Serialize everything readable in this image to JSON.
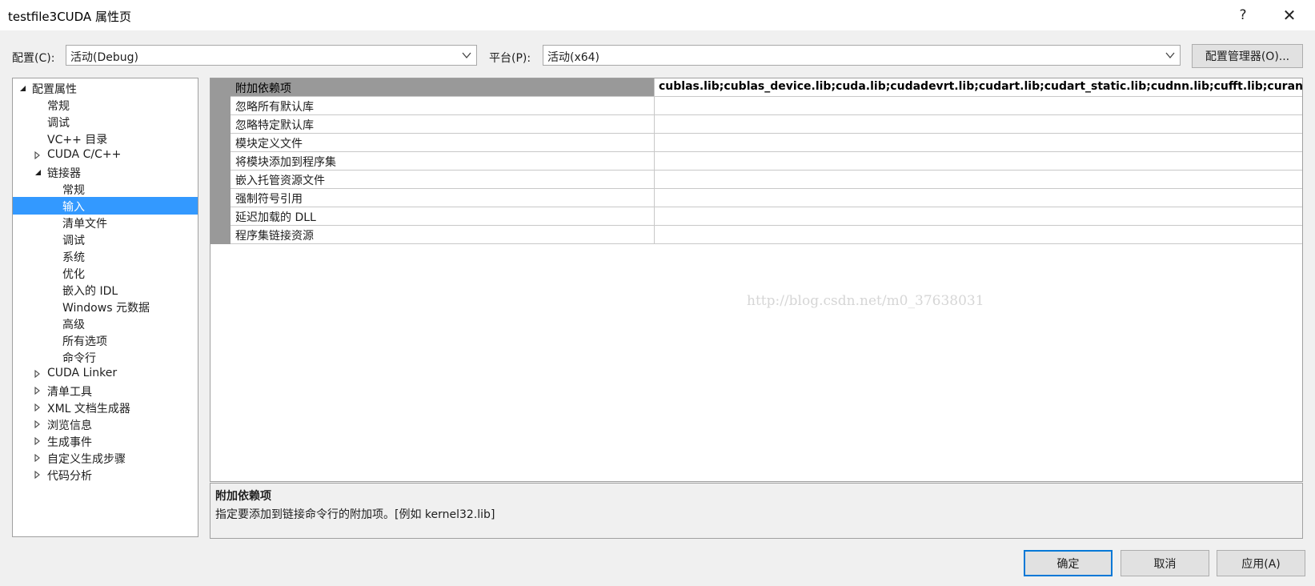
{
  "window": {
    "title": "testfile3CUDA 属性页",
    "help_label": "?",
    "close_label": "✕"
  },
  "config": {
    "config_label": "配置(C):",
    "config_value": "活动(Debug)",
    "platform_label": "平台(P):",
    "platform_value": "活动(x64)",
    "manager_button": "配置管理器(O)..."
  },
  "tree": {
    "items": [
      {
        "label": "配置属性",
        "expander": "expanded",
        "selected": false
      },
      {
        "label": "常规",
        "expander": "none",
        "selected": false
      },
      {
        "label": "调试",
        "expander": "none",
        "selected": false
      },
      {
        "label": "VC++ 目录",
        "expander": "none",
        "selected": false
      },
      {
        "label": "CUDA C/C++",
        "expander": "collapsed",
        "selected": false
      },
      {
        "label": "链接器",
        "expander": "expanded",
        "selected": false
      },
      {
        "label": "常规",
        "expander": "none",
        "selected": false
      },
      {
        "label": "输入",
        "expander": "none",
        "selected": true
      },
      {
        "label": "清单文件",
        "expander": "none",
        "selected": false
      },
      {
        "label": "调试",
        "expander": "none",
        "selected": false
      },
      {
        "label": "系统",
        "expander": "none",
        "selected": false
      },
      {
        "label": "优化",
        "expander": "none",
        "selected": false
      },
      {
        "label": "嵌入的 IDL",
        "expander": "none",
        "selected": false
      },
      {
        "label": "Windows 元数据",
        "expander": "none",
        "selected": false
      },
      {
        "label": "高级",
        "expander": "none",
        "selected": false
      },
      {
        "label": "所有选项",
        "expander": "none",
        "selected": false
      },
      {
        "label": "命令行",
        "expander": "none",
        "selected": false
      },
      {
        "label": "CUDA Linker",
        "expander": "collapsed",
        "selected": false
      },
      {
        "label": "清单工具",
        "expander": "collapsed",
        "selected": false
      },
      {
        "label": "XML 文档生成器",
        "expander": "collapsed",
        "selected": false
      },
      {
        "label": "浏览信息",
        "expander": "collapsed",
        "selected": false
      },
      {
        "label": "生成事件",
        "expander": "collapsed",
        "selected": false
      },
      {
        "label": "自定义生成步骤",
        "expander": "collapsed",
        "selected": false
      },
      {
        "label": "代码分析",
        "expander": "collapsed",
        "selected": false
      }
    ]
  },
  "properties": {
    "rows": [
      {
        "name": "附加依赖项",
        "value": "cublas.lib;cublas_device.lib;cuda.lib;cudadevrt.lib;cudart.lib;cudart_static.lib;cudnn.lib;cufft.lib;curand.lib;cus",
        "selected": true
      },
      {
        "name": "忽略所有默认库",
        "value": "",
        "selected": false
      },
      {
        "name": "忽略特定默认库",
        "value": "",
        "selected": false
      },
      {
        "name": "模块定义文件",
        "value": "",
        "selected": false
      },
      {
        "name": "将模块添加到程序集",
        "value": "",
        "selected": false
      },
      {
        "name": "嵌入托管资源文件",
        "value": "",
        "selected": false
      },
      {
        "name": "强制符号引用",
        "value": "",
        "selected": false
      },
      {
        "name": "延迟加载的 DLL",
        "value": "",
        "selected": false
      },
      {
        "name": "程序集链接资源",
        "value": "",
        "selected": false
      }
    ],
    "watermark": "http://blog.csdn.net/m0_37638031"
  },
  "description": {
    "title": "附加依赖项",
    "text": "指定要添加到链接命令行的附加项。[例如 kernel32.lib]"
  },
  "buttons": {
    "ok": "确定",
    "cancel": "取消",
    "apply": "应用(A)"
  },
  "colors": {
    "selection": "#3399ff",
    "grid_selected": "#999999",
    "default_button_border": "#0078d7"
  }
}
